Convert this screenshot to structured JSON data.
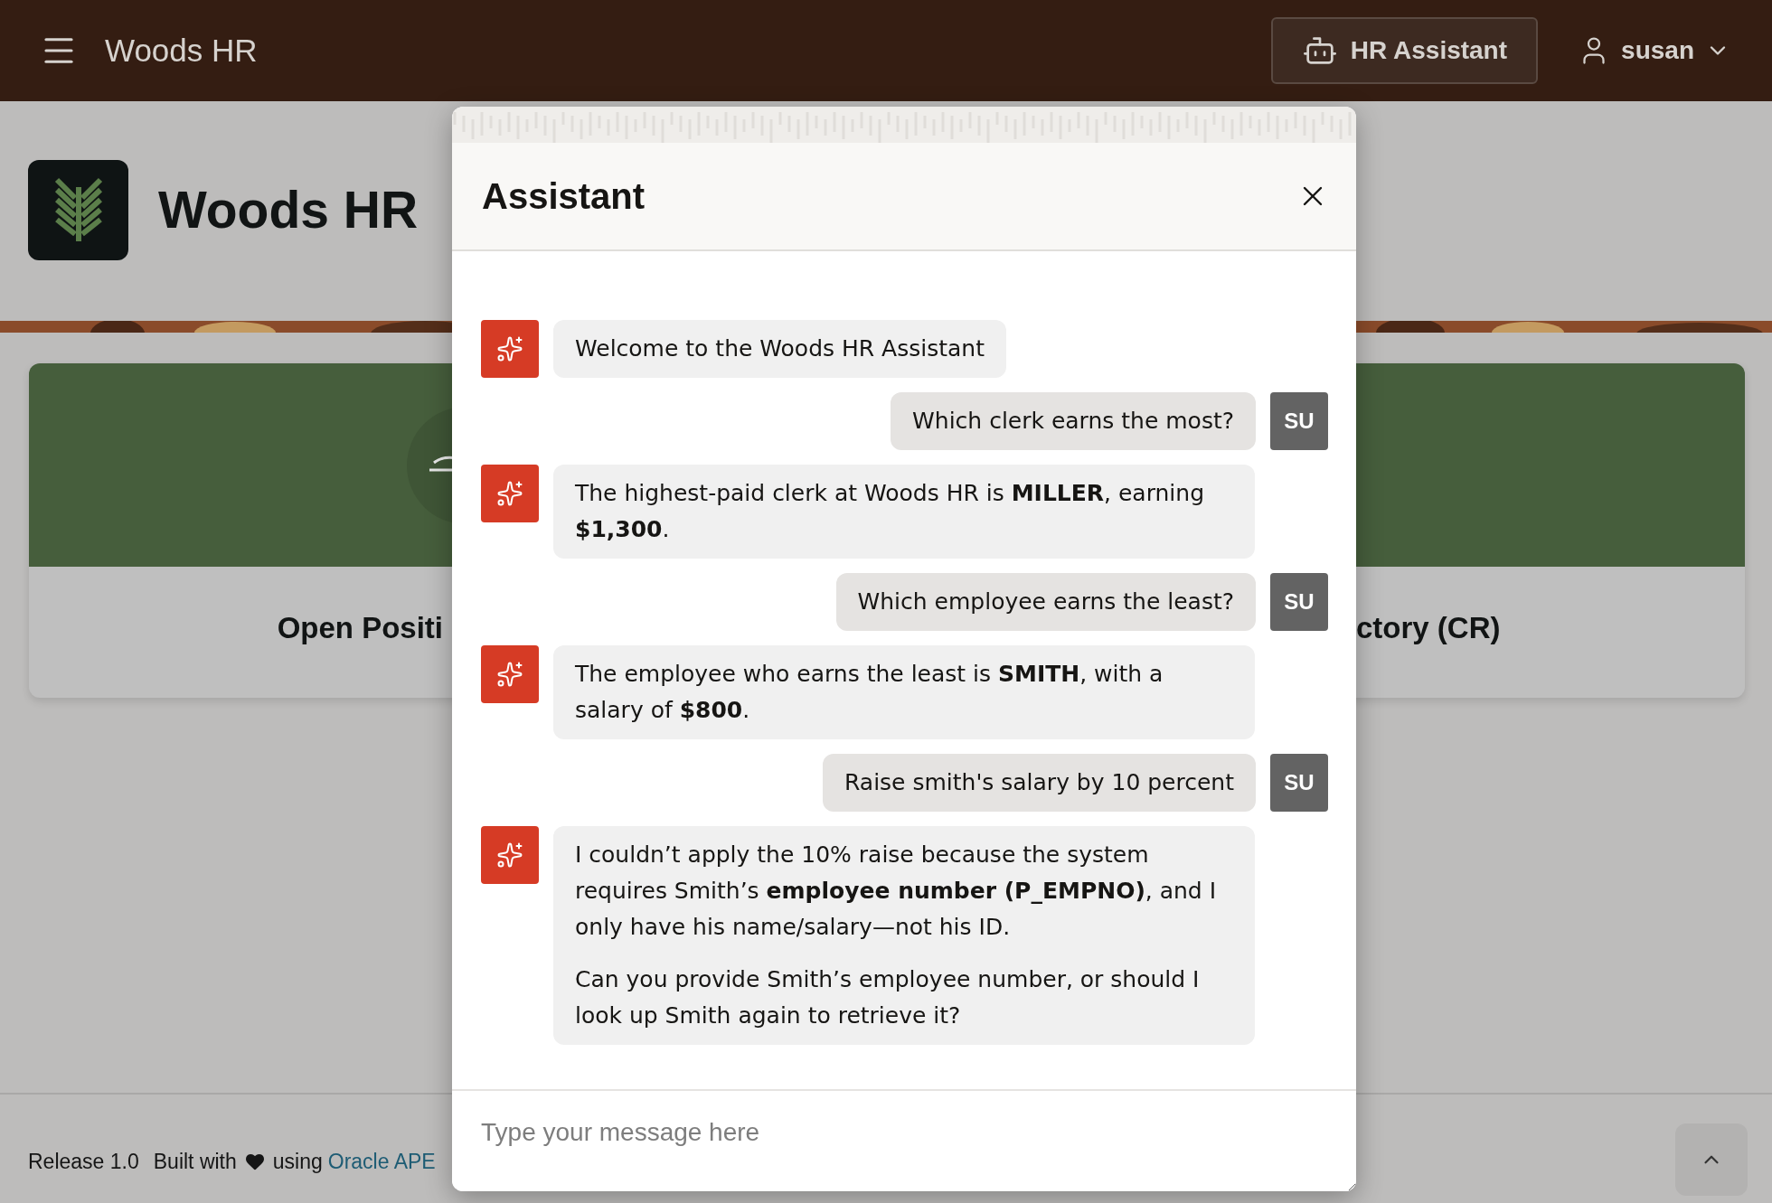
{
  "app_header": {
    "title": "Woods HR",
    "assistant_button": "HR Assistant",
    "user": "susan"
  },
  "banner": {
    "title": "Woods HR"
  },
  "cards": [
    {
      "label": "Open Positi"
    },
    {
      "label": "ctory (CR)"
    }
  ],
  "footer": {
    "release": "Release 1.0",
    "built_with": "Built with",
    "using": "using",
    "link": "Oracle APE"
  },
  "dialog": {
    "title": "Assistant",
    "messages": [
      {
        "kind": "assistant",
        "paragraphs": [
          "Welcome to the Woods HR Assistant"
        ]
      },
      {
        "kind": "user",
        "initials": "SU",
        "paragraphs": [
          "Which clerk earns the most?"
        ]
      },
      {
        "kind": "assistant",
        "paragraphs": [
          "The highest-paid clerk at Woods HR is **MILLER**, earning **$1,300**."
        ]
      },
      {
        "kind": "user",
        "initials": "SU",
        "paragraphs": [
          "Which employee earns the least?"
        ]
      },
      {
        "kind": "assistant",
        "paragraphs": [
          "The employee who earns the least is **SMITH**, with a salary of **$800**."
        ]
      },
      {
        "kind": "user",
        "initials": "SU",
        "paragraphs": [
          "Raise smith's salary by 10 percent"
        ]
      },
      {
        "kind": "assistant",
        "paragraphs": [
          "I couldn’t apply the 10% raise because the system requires Smith’s **employee number (P_EMPNO)**, and I only have his name/salary—not his ID.",
          "Can you provide Smith’s employee number, or should I look up Smith again to retrieve it?"
        ]
      }
    ],
    "input": {
      "placeholder": "Type your message here"
    }
  }
}
